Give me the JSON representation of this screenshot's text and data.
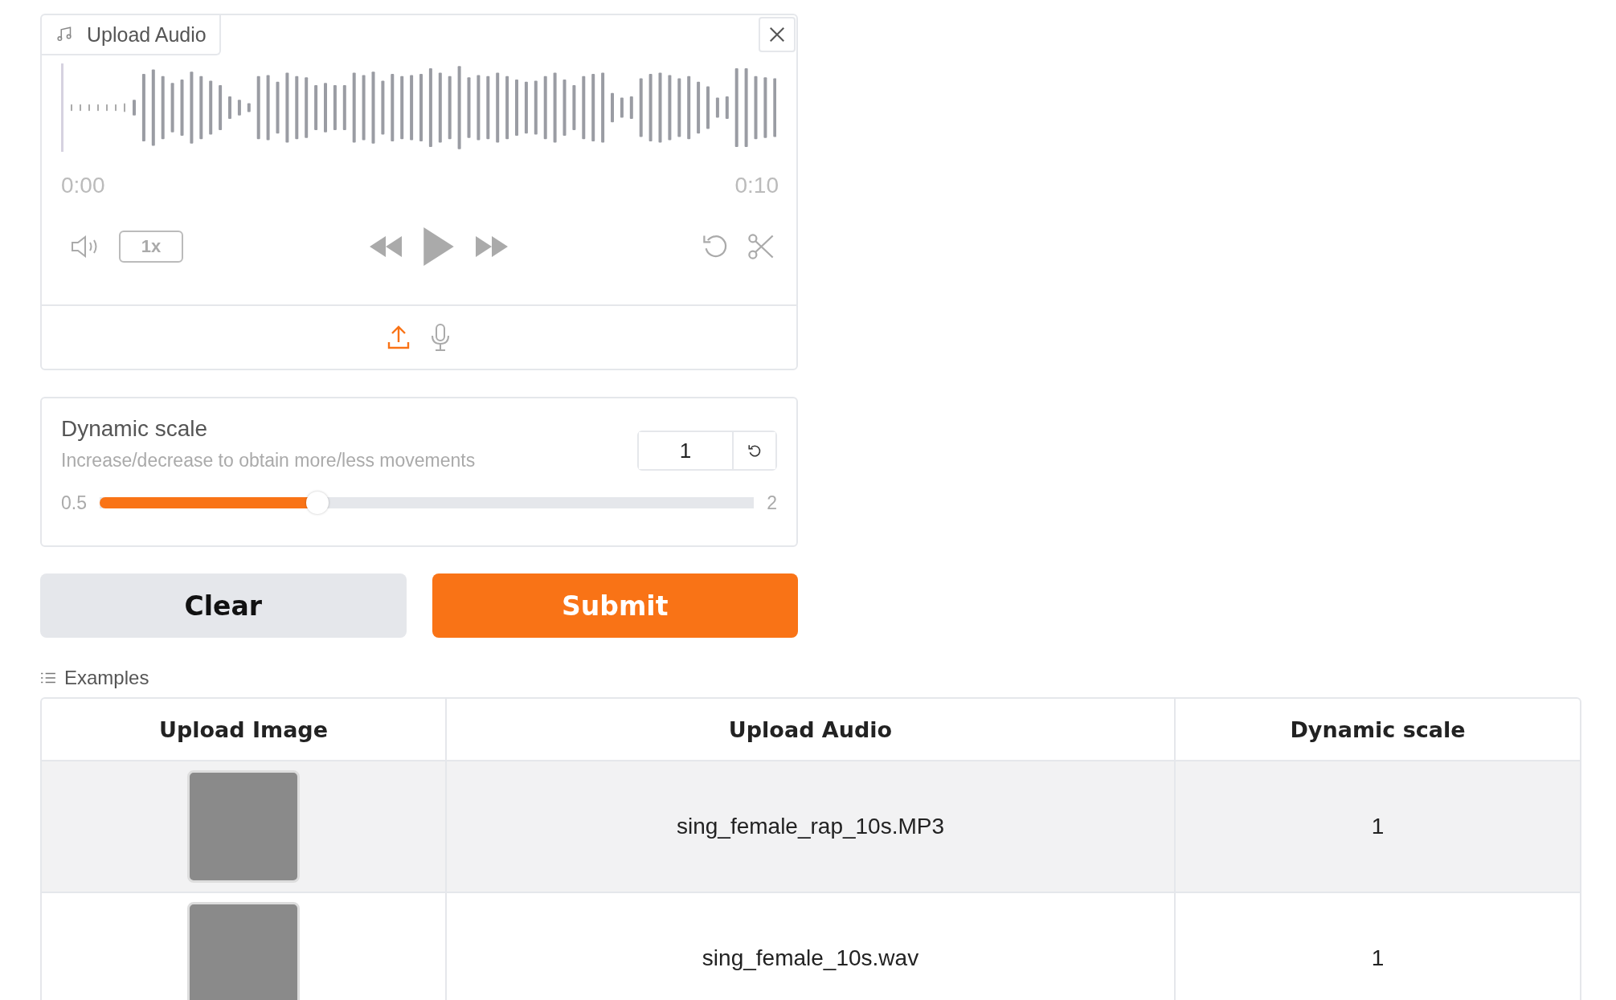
{
  "audio_input": {
    "label": "Upload Audio",
    "current_time": "0:00",
    "duration": "0:10",
    "playback_rate": "1x"
  },
  "dynamic_scale": {
    "label": "Dynamic scale",
    "info": "Increase/decrease to obtain more/less movements",
    "value": "1",
    "min": "0.5",
    "max": "2",
    "level": 0.333
  },
  "buttons": [
    {
      "label": "Clear",
      "kind": "secondary"
    },
    {
      "label": "Submit",
      "kind": "primary"
    }
  ],
  "examples": {
    "label": "Examples",
    "columns": [
      "Upload Image",
      "Upload Audio",
      "Dynamic scale"
    ],
    "rows": [
      {
        "audio": "sing_female_rap_10s.MP3",
        "dynamic_scale": "1",
        "hovered": true
      },
      {
        "audio": "sing_female_10s.wav",
        "dynamic_scale": "1",
        "hovered": false
      }
    ]
  }
}
